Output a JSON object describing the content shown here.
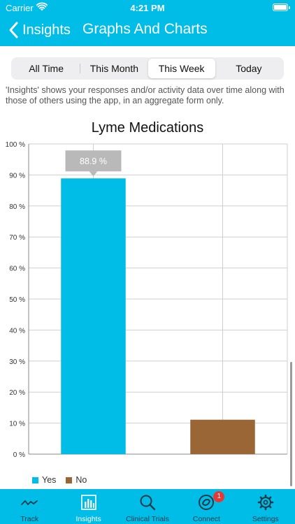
{
  "status_bar": {
    "carrier": "Carrier",
    "time": "4:21 PM"
  },
  "nav": {
    "back_label": "Insights",
    "title": "Graphs And Charts"
  },
  "segments": [
    {
      "label": "All Time",
      "active": false
    },
    {
      "label": "This Month",
      "active": false
    },
    {
      "label": "This Week",
      "active": true
    },
    {
      "label": "Today",
      "active": false
    }
  ],
  "description": "'Insights' shows your responses and/or activity data over time along with those of others using the app, in an aggregate form only.",
  "chart_data": {
    "type": "bar",
    "title": "Lyme Medications",
    "categories": [
      "Yes",
      "No"
    ],
    "values": [
      88.9,
      11.1
    ],
    "colors": [
      "#00bde8",
      "#9a6636"
    ],
    "ylim": [
      0,
      100
    ],
    "y_ticks": [
      "0 %",
      "10 %",
      "20 %",
      "30 %",
      "40 %",
      "50 %",
      "60 %",
      "70 %",
      "80 %",
      "90 %",
      "100 %"
    ],
    "tooltip": {
      "category": "Yes",
      "text": "88.9 %"
    },
    "legend": {
      "placement": "bottom-left",
      "entries": [
        "Yes",
        "No"
      ]
    },
    "grid": true
  },
  "tabs": [
    {
      "label": "Track",
      "icon": "track-wave-icon",
      "active": false
    },
    {
      "label": "Insights",
      "icon": "bar-chart-icon",
      "active": true
    },
    {
      "label": "Clinical Trials",
      "icon": "search-icon",
      "active": false
    },
    {
      "label": "Connect",
      "icon": "connect-icon",
      "active": false,
      "badge": "1"
    },
    {
      "label": "Settings",
      "icon": "gear-icon",
      "active": false
    }
  ],
  "colors": {
    "accent": "#00bde8",
    "bar_yes": "#00bde8",
    "bar_no": "#9a6636",
    "badge": "#e53935"
  }
}
